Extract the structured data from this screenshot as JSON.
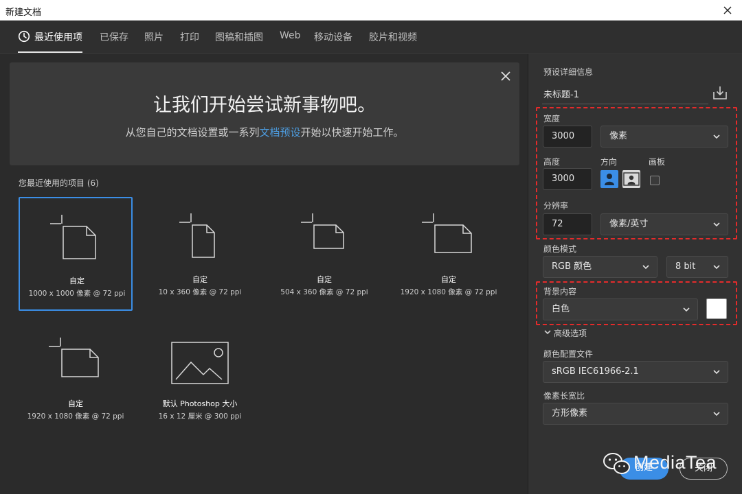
{
  "window": {
    "title": "新建文档"
  },
  "tabs": [
    {
      "label": "最近使用项",
      "active": true
    },
    {
      "label": "已保存"
    },
    {
      "label": "照片"
    },
    {
      "label": "打印"
    },
    {
      "label": "图稿和插图"
    },
    {
      "label": "Web"
    },
    {
      "label": "移动设备"
    },
    {
      "label": "胶片和视频"
    }
  ],
  "hero": {
    "headline": "让我们开始尝试新事物吧。",
    "sub_before": "从您自己的文档设置或一系列",
    "sub_link": "文档预设",
    "sub_after": "开始以快速开始工作。"
  },
  "recent": {
    "title": "您最近使用的项目 (6)",
    "items": [
      {
        "name": "自定",
        "meta": "1000 x 1000 像素 @ 72 ppi",
        "icon": "custom-document-square-icon",
        "selected": true
      },
      {
        "name": "自定",
        "meta": "10 x 360 像素 @ 72 ppi",
        "icon": "custom-document-portrait-icon"
      },
      {
        "name": "自定",
        "meta": "504 x 360 像素 @ 72 ppi",
        "icon": "custom-document-landscape-icon"
      },
      {
        "name": "自定",
        "meta": "1920 x 1080 像素 @ 72 ppi",
        "icon": "custom-document-landscape-icon"
      },
      {
        "name": "自定",
        "meta": "1920 x 1080 像素 @ 72 ppi",
        "icon": "custom-document-landscape-icon"
      },
      {
        "name": "默认 Photoshop 大小",
        "meta": "16 x 12 厘米 @ 300 ppi",
        "icon": "image-thumbnail-icon"
      }
    ]
  },
  "details": {
    "title": "预设详细信息",
    "preset_name": "未标题-1",
    "width_label": "宽度",
    "width_value": "3000",
    "width_unit": "像素",
    "height_label": "高度",
    "height_value": "3000",
    "orientation_label": "方向",
    "artboard_label": "画板",
    "resolution_label": "分辨率",
    "resolution_value": "72",
    "resolution_unit": "像素/英寸",
    "color_mode_label": "颜色模式",
    "color_mode_value": "RGB 颜色",
    "bit_depth_value": "8 bit",
    "background_label": "背景内容",
    "background_value": "白色",
    "background_swatch": "#ffffff",
    "advanced_label": "高级选项",
    "profile_label": "颜色配置文件",
    "profile_value": "sRGB IEC61966-2.1",
    "aspect_label": "像素长宽比",
    "aspect_value": "方形像素"
  },
  "buttons": {
    "create": "创建",
    "close": "关闭"
  },
  "watermark": {
    "text": "MediaTea"
  },
  "colors": {
    "accent": "#3b8ee6",
    "highlight_dash": "#e52b2b",
    "panel": "#323232",
    "background": "#2b2b2b"
  }
}
